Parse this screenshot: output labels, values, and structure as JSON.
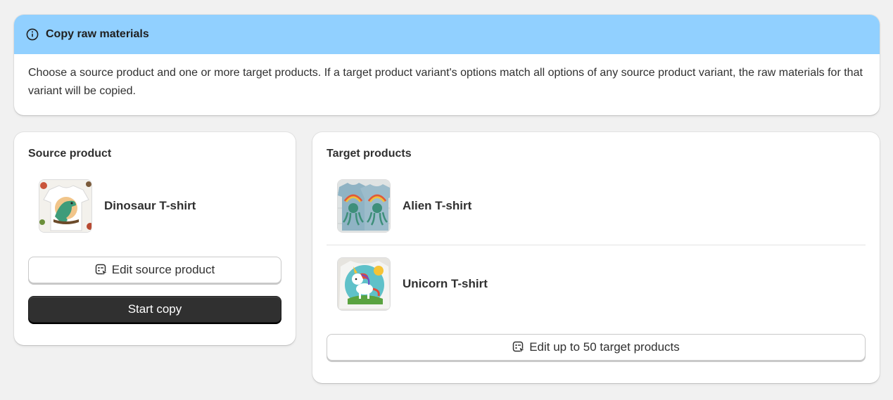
{
  "banner": {
    "title": "Copy raw materials",
    "icon": "info-icon",
    "color": "#91d0ff",
    "body": "Choose a source product and one or more target products. If a target product variant's options match all options of any source product variant, the raw materials for that variant will be copied."
  },
  "source": {
    "title": "Source product",
    "product": {
      "name": "Dinosaur T-shirt",
      "image": "dinosaur-tshirt-image"
    },
    "edit_label": "Edit source product",
    "edit_icon": "product-select-icon",
    "start_label": "Start copy"
  },
  "target": {
    "title": "Target products",
    "products": [
      {
        "name": "Alien T-shirt",
        "image": "alien-tshirt-image"
      },
      {
        "name": "Unicorn T-shirt",
        "image": "unicorn-tshirt-image"
      }
    ],
    "edit_label": "Edit up to 50 target products",
    "edit_icon": "product-select-icon"
  }
}
